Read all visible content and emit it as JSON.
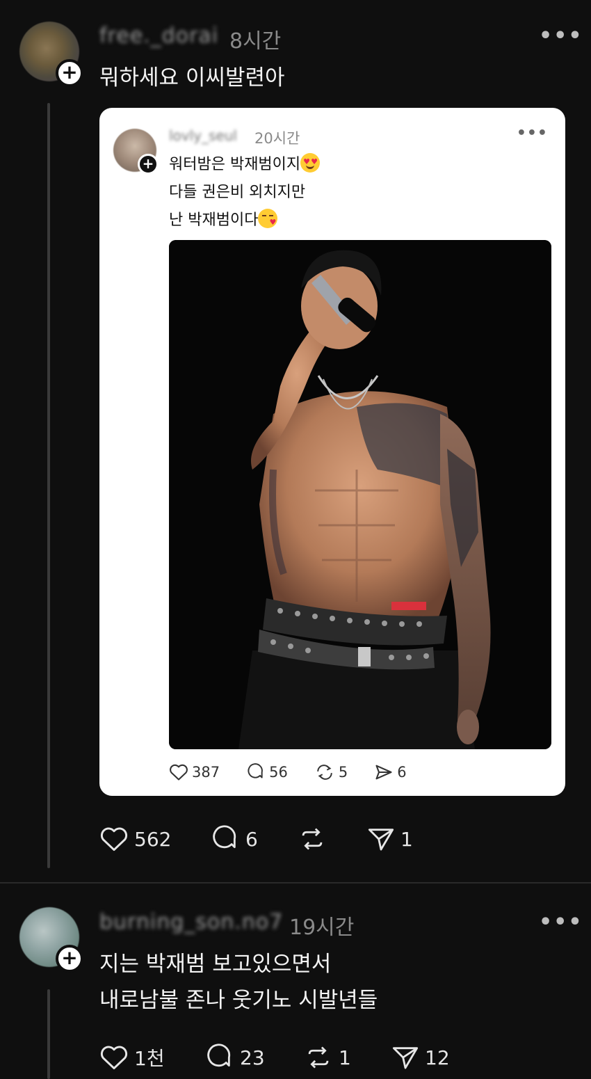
{
  "posts": [
    {
      "username": "free._dorai",
      "time": "8시간",
      "more": "•••",
      "text": "뭐하세요 이씨발련아",
      "quote": {
        "username": "lovly_seul",
        "time": "20시간",
        "more": "•••",
        "lines": [
          "워터밤은 박재범이지",
          "다들 권은비 외치지만",
          "난 박재범이다"
        ],
        "photo": "Shirtless tattooed performer singing into a microphone on a dark stage",
        "actions": {
          "likes": "387",
          "replies": "56",
          "reposts": "5",
          "shares": "6"
        }
      },
      "actions": {
        "likes": "562",
        "replies": "6",
        "reposts": "",
        "shares": "1"
      }
    },
    {
      "username": "burning_son.no7",
      "time": "19시간",
      "more": "•••",
      "lines": [
        "지는 박재범 보고있으면서",
        "내로남불 존나 웃기노 시발년들"
      ],
      "actions": {
        "likes": "1천",
        "replies": "23",
        "reposts": "1",
        "shares": "12"
      }
    }
  ],
  "icons": [
    "heart-icon",
    "comment-icon",
    "repost-icon",
    "send-icon",
    "plus-icon",
    "more-icon"
  ]
}
